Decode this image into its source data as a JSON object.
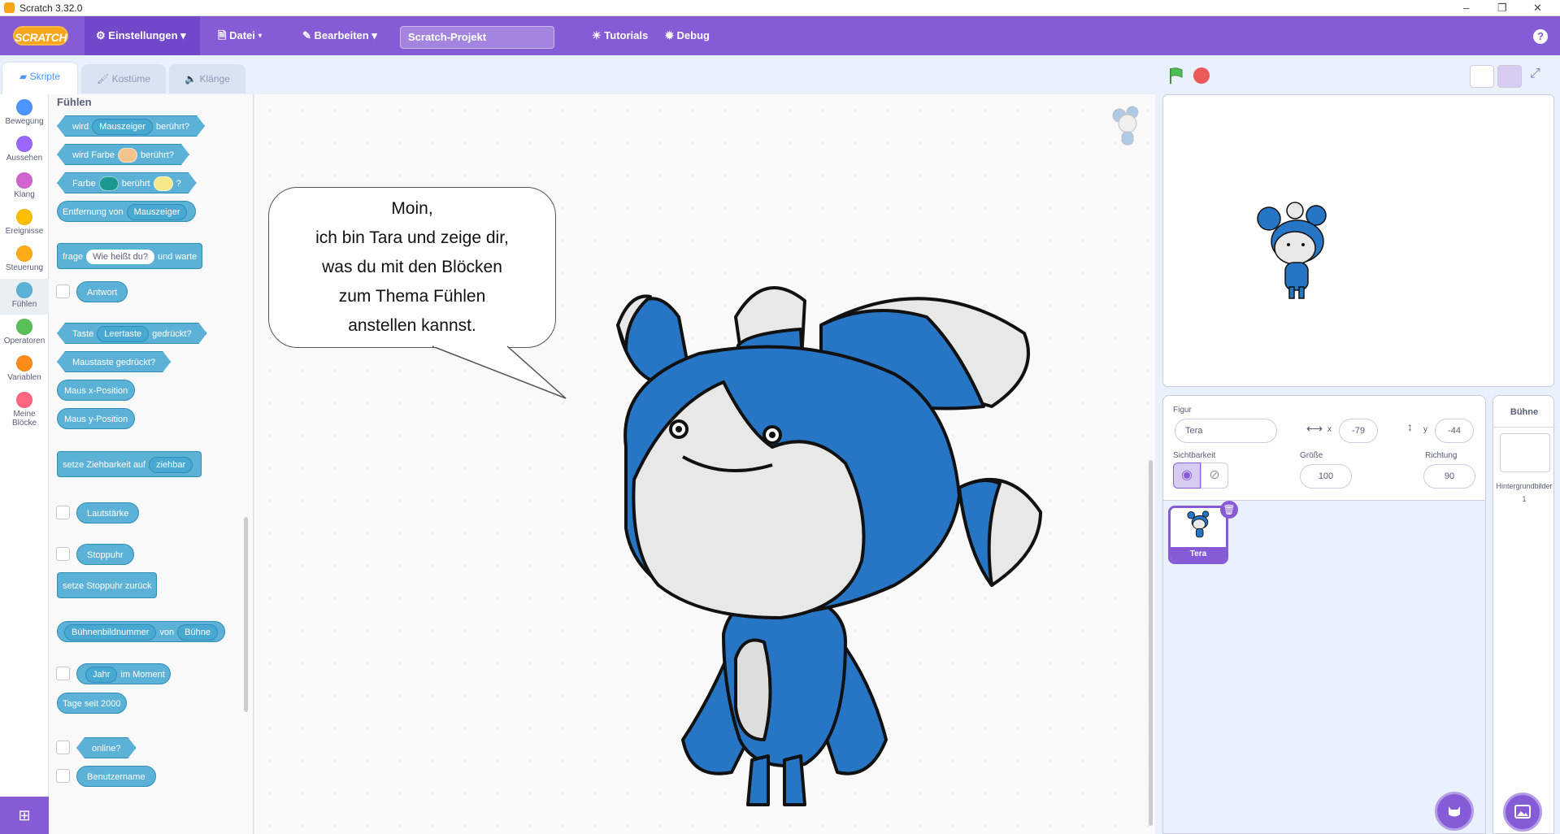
{
  "window": {
    "title": "Scratch 3.32.0",
    "minimize": "–",
    "restore": "❐",
    "close": "✕"
  },
  "menu": {
    "logo": "SCRATCH",
    "settings": "Einstellungen",
    "file": "Datei",
    "edit": "Bearbeiten",
    "project_title": "Scratch-Projekt",
    "tutorials": "Tutorials",
    "debug": "Debug",
    "help": "?"
  },
  "tabs": {
    "scripts": "Skripte",
    "costumes": "Kostüme",
    "sounds": "Klänge"
  },
  "categories": [
    {
      "label": "Bewegung",
      "color": "#4c97ff"
    },
    {
      "label": "Aussehen",
      "color": "#9966ff"
    },
    {
      "label": "Klang",
      "color": "#cf63cf"
    },
    {
      "label": "Ereignisse",
      "color": "#ffbf00"
    },
    {
      "label": "Steuerung",
      "color": "#ffab19"
    },
    {
      "label": "Fühlen",
      "color": "#5cb1d6"
    },
    {
      "label": "Operatoren",
      "color": "#59c059"
    },
    {
      "label": "Variablen",
      "color": "#ff8c1a"
    },
    {
      "label": "Meine",
      "label2": "Blöcke",
      "color": "#ff6680"
    }
  ],
  "palette": {
    "heading": "Fühlen",
    "touching_a": "wird",
    "touching_dd": "Mauszeiger",
    "touching_b": "berührt?",
    "color_a": "wird Farbe",
    "color_b": "berührt?",
    "cc_a": "Farbe",
    "cc_b": "berührt",
    "cc_c": "?",
    "dist_a": "Entfernung von",
    "dist_dd": "Mauszeiger",
    "ask_a": "frage",
    "ask_field": "Wie heißt du?",
    "ask_b": "und warte",
    "answer": "Antwort",
    "key_a": "Taste",
    "key_dd": "Leertaste",
    "key_b": "gedrückt?",
    "mouse_down": "Maustaste gedrückt?",
    "mouse_x": "Maus x-Position",
    "mouse_y": "Maus y-Position",
    "drag_a": "setze Ziehbarkeit auf",
    "drag_dd": "ziehbar",
    "loudness": "Lautstärke",
    "timer": "Stoppuhr",
    "reset_timer": "setze Stoppuhr zurück",
    "of_a": "Bühnenbildnummer",
    "of_b": "von",
    "of_dd": "Bühne",
    "current_dd": "Jahr",
    "current_b": "im Moment",
    "days": "Tage seit 2000",
    "online": "online?",
    "username": "Benutzername"
  },
  "bubble": {
    "line1": "Moin,",
    "line2": "ich bin Tara und zeige dir,",
    "line3": "was du mit den Blöcken",
    "line4": "zum Thema Fühlen",
    "line5": "anstellen kannst."
  },
  "zoom": {
    "in": "+",
    "out": "−",
    "reset": "="
  },
  "sprite": {
    "label_sprite": "Figur",
    "name": "Tera",
    "x_label": "x",
    "x": "-79",
    "y_label": "y",
    "y": "-44",
    "visibility_label": "Sichtbarkeit",
    "size_label": "Größe",
    "size": "100",
    "direction_label": "Richtung",
    "direction": "90"
  },
  "sprite_list": [
    {
      "name": "Tera"
    }
  ],
  "stage_panel": {
    "title": "Bühne",
    "backdrops_label": "Hintergrundbilder",
    "backdrops_count": "1"
  },
  "colors": {
    "accent": "#855cd6",
    "sensing": "#5cb1d6",
    "tara_blue": "#2775c5"
  }
}
